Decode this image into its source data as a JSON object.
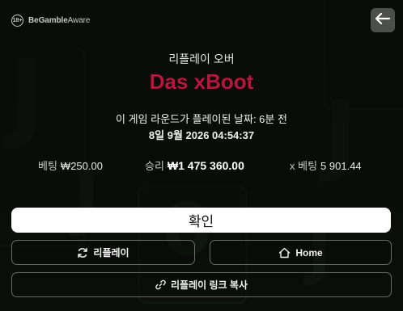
{
  "bga": {
    "age": "18+",
    "brand_bold": "BeGamble",
    "brand_rest": "Aware"
  },
  "header": {
    "subtitle": "리플레이 오버",
    "title": "Das xBoot"
  },
  "round": {
    "played_text": "이 게임 라운드가 플레이된 날짜: 6분 전",
    "datetime": "8일 9월 2026 04:54:37"
  },
  "stats": {
    "bet_label": "베팅",
    "bet_value": "₩250.00",
    "win_label": "승리",
    "win_value": "₩1 475 360.00",
    "multiplier_label": "x 베팅",
    "multiplier_value": "5 901.44"
  },
  "buttons": {
    "confirm": "확인",
    "replay": "리플레이",
    "home": "Home",
    "copy_link": "리플레이 링크 복사"
  },
  "icons": [
    "back-arrow-icon",
    "replay-icon",
    "home-icon",
    "link-icon"
  ],
  "colors": {
    "title": "#b8163a",
    "primary_button": "#ffffff",
    "back_button": "#4d4f4d"
  }
}
